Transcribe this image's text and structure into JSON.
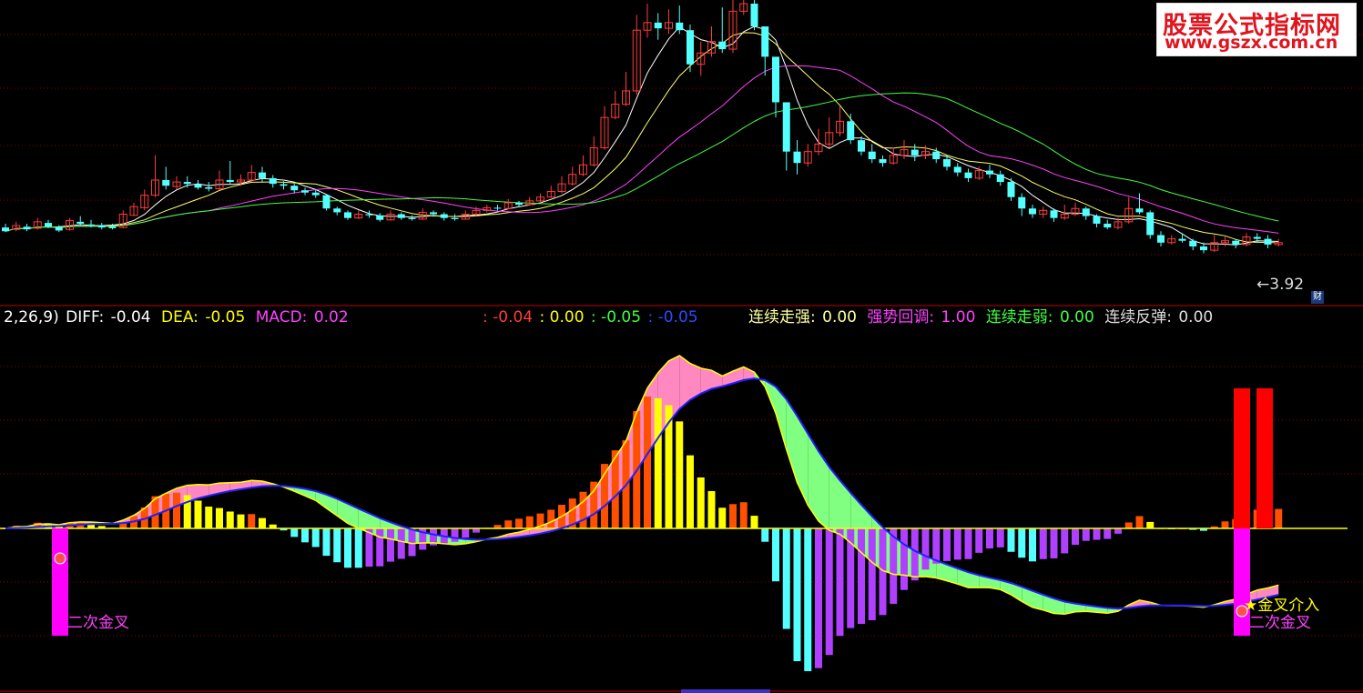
{
  "watermark": {
    "line1": "股票公式指标网",
    "line2": "www.gszx.com.cn"
  },
  "price_panel": {
    "last_price_label": "3.92",
    "badge": "财"
  },
  "legend": {
    "params": "2,26,9)",
    "diff_label": "DIFF:",
    "diff_value": "-0.04",
    "dea_label": "DEA:",
    "dea_value": "-0.05",
    "macd_label": "MACD:",
    "macd_value": "0.02",
    "v1": ": -0.04",
    "v2": ": 0.00",
    "v3": ": -0.05",
    "v4": ": -0.05",
    "s1_label": "连续走强:",
    "s1_value": "0.00",
    "s2_label": "强势回调:",
    "s2_value": "1.00",
    "s3_label": "连续走弱:",
    "s3_value": "0.00",
    "s4_label": "连续反弹:",
    "s4_value": "0.00"
  },
  "signals": {
    "second_golden_cross": "二次金叉",
    "golden_cross_buy": "★金叉介入"
  },
  "colors": {
    "up": "#ff3c3c",
    "down": "#54ffff",
    "ma5": "#ffffff",
    "ma10": "#ffff66",
    "ma20": "#ff40ff",
    "ma30": "#40ff40",
    "diff": "#ffff00",
    "dea": "#2020ff",
    "bar_orange": "#ff5000",
    "bar_yellow": "#ffff00",
    "bar_cyan": "#54ffff",
    "bar_violet": "#b040ff",
    "fill_pink": "#ff88c0",
    "fill_green": "#80ff80",
    "signal_magenta": "#ff00ff",
    "signal_red": "#ff0000"
  },
  "chart_data": [
    {
      "type": "candlestick",
      "title": "",
      "ylabel": "",
      "ylim": [
        3.5,
        10.5
      ],
      "candles": [
        [
          4.6,
          4.5,
          4.7,
          4.48
        ],
        [
          4.55,
          4.65,
          4.75,
          4.5
        ],
        [
          4.62,
          4.55,
          4.7,
          4.5
        ],
        [
          4.58,
          4.75,
          4.85,
          4.55
        ],
        [
          4.72,
          4.62,
          4.8,
          4.58
        ],
        [
          4.6,
          4.52,
          4.66,
          4.48
        ],
        [
          4.55,
          4.78,
          4.85,
          4.52
        ],
        [
          4.75,
          4.7,
          4.9,
          4.65
        ],
        [
          4.68,
          4.65,
          4.8,
          4.6
        ],
        [
          4.66,
          4.6,
          4.72,
          4.55
        ],
        [
          4.62,
          4.58,
          4.7,
          4.55
        ],
        [
          4.6,
          4.95,
          5.05,
          4.58
        ],
        [
          4.92,
          5.15,
          5.25,
          4.9
        ],
        [
          5.12,
          5.45,
          5.6,
          5.05
        ],
        [
          5.45,
          5.85,
          6.5,
          5.4
        ],
        [
          5.85,
          5.7,
          6.2,
          5.6
        ],
        [
          5.68,
          5.8,
          5.95,
          5.6
        ],
        [
          5.8,
          5.75,
          5.95,
          5.65
        ],
        [
          5.74,
          5.65,
          5.85,
          5.6
        ],
        [
          5.66,
          5.62,
          5.8,
          5.55
        ],
        [
          5.62,
          5.85,
          6.1,
          5.58
        ],
        [
          5.85,
          5.8,
          6.35,
          5.75
        ],
        [
          5.8,
          5.85,
          6.0,
          5.7
        ],
        [
          5.85,
          6.05,
          6.25,
          5.8
        ],
        [
          6.05,
          5.9,
          6.2,
          5.8
        ],
        [
          5.9,
          5.75,
          5.98,
          5.65
        ],
        [
          5.74,
          5.7,
          5.82,
          5.6
        ],
        [
          5.7,
          5.58,
          5.75,
          5.5
        ],
        [
          5.58,
          5.52,
          5.65,
          5.45
        ],
        [
          5.52,
          5.45,
          5.6,
          5.38
        ],
        [
          5.45,
          5.1,
          5.48,
          5.05
        ],
        [
          5.1,
          5.0,
          5.15,
          4.92
        ],
        [
          5.0,
          4.85,
          5.05,
          4.8
        ],
        [
          4.85,
          4.95,
          5.05,
          4.82
        ],
        [
          4.95,
          4.92,
          5.05,
          4.85
        ],
        [
          4.92,
          4.8,
          4.98,
          4.75
        ],
        [
          4.8,
          4.95,
          5.05,
          4.78
        ],
        [
          4.95,
          4.85,
          5.0,
          4.8
        ],
        [
          4.85,
          4.82,
          4.92,
          4.78
        ],
        [
          4.82,
          5.0,
          5.1,
          4.8
        ],
        [
          5.0,
          4.95,
          5.05,
          4.88
        ],
        [
          4.95,
          4.85,
          5.0,
          4.78
        ],
        [
          4.85,
          4.82,
          4.95,
          4.78
        ],
        [
          4.82,
          4.95,
          5.05,
          4.8
        ],
        [
          4.95,
          5.05,
          5.15,
          4.9
        ],
        [
          5.05,
          5.12,
          5.2,
          5.0
        ],
        [
          5.12,
          5.1,
          5.2,
          5.05
        ],
        [
          5.1,
          5.25,
          5.35,
          5.08
        ],
        [
          5.25,
          5.2,
          5.3,
          5.15
        ],
        [
          5.2,
          5.3,
          5.4,
          5.18
        ],
        [
          5.3,
          5.4,
          5.5,
          5.25
        ],
        [
          5.4,
          5.55,
          5.7,
          5.38
        ],
        [
          5.55,
          5.75,
          5.95,
          5.5
        ],
        [
          5.75,
          6.0,
          6.2,
          5.7
        ],
        [
          6.0,
          6.25,
          6.5,
          5.95
        ],
        [
          6.25,
          6.7,
          7.0,
          6.2
        ],
        [
          6.7,
          7.5,
          7.8,
          6.65
        ],
        [
          7.5,
          7.85,
          8.2,
          7.45
        ],
        [
          7.85,
          8.2,
          8.7,
          7.8
        ],
        [
          8.2,
          9.8,
          10.2,
          8.1
        ],
        [
          9.8,
          10.0,
          10.5,
          9.6
        ],
        [
          10.0,
          9.85,
          10.25,
          9.55
        ],
        [
          9.85,
          10.0,
          10.35,
          9.7
        ],
        [
          10.0,
          9.8,
          10.45,
          9.7
        ],
        [
          9.8,
          8.9,
          9.95,
          8.7
        ],
        [
          8.9,
          9.2,
          9.5,
          8.6
        ],
        [
          9.2,
          9.5,
          9.9,
          9.1
        ],
        [
          9.5,
          9.3,
          10.4,
          9.2
        ],
        [
          9.3,
          10.3,
          10.6,
          9.2
        ],
        [
          10.3,
          10.5,
          10.8,
          10.2
        ],
        [
          10.5,
          9.9,
          10.6,
          9.8
        ],
        [
          9.9,
          9.1,
          9.6,
          8.6
        ],
        [
          9.1,
          7.9,
          8.3,
          7.5
        ],
        [
          7.9,
          6.6,
          7.4,
          6.1
        ],
        [
          6.6,
          6.3,
          6.9,
          6.0
        ],
        [
          6.3,
          6.6,
          6.8,
          6.2
        ],
        [
          6.6,
          6.8,
          7.2,
          6.5
        ],
        [
          6.8,
          7.1,
          7.5,
          6.7
        ],
        [
          7.1,
          7.4,
          7.8,
          7.0
        ],
        [
          7.4,
          6.9,
          7.6,
          6.8
        ],
        [
          6.9,
          6.6,
          7.0,
          6.5
        ],
        [
          6.6,
          6.4,
          6.8,
          6.3
        ],
        [
          6.4,
          6.3,
          6.5,
          6.2
        ],
        [
          6.3,
          6.5,
          6.7,
          6.25
        ],
        [
          6.5,
          6.65,
          6.9,
          6.4
        ],
        [
          6.65,
          6.5,
          6.8,
          6.35
        ],
        [
          6.5,
          6.6,
          6.75,
          6.4
        ],
        [
          6.6,
          6.4,
          6.7,
          6.3
        ],
        [
          6.4,
          6.2,
          6.5,
          6.1
        ],
        [
          6.2,
          6.05,
          6.3,
          5.95
        ],
        [
          6.05,
          5.9,
          6.15,
          5.8
        ],
        [
          5.9,
          6.1,
          6.2,
          5.85
        ],
        [
          6.1,
          6.0,
          6.25,
          5.9
        ],
        [
          6.0,
          5.8,
          6.1,
          5.7
        ],
        [
          5.8,
          5.4,
          5.9,
          5.3
        ],
        [
          5.4,
          5.1,
          5.5,
          4.9
        ],
        [
          5.1,
          4.95,
          5.2,
          4.85
        ],
        [
          4.95,
          5.05,
          5.15,
          4.85
        ],
        [
          5.05,
          4.85,
          5.1,
          4.75
        ],
        [
          4.85,
          4.95,
          5.2,
          4.8
        ],
        [
          4.95,
          5.1,
          5.25,
          4.9
        ],
        [
          5.1,
          4.9,
          5.15,
          4.8
        ],
        [
          4.9,
          4.7,
          4.95,
          4.6
        ],
        [
          4.7,
          4.6,
          4.8,
          4.55
        ],
        [
          4.6,
          4.75,
          4.85,
          4.55
        ],
        [
          4.75,
          5.1,
          5.4,
          4.7
        ],
        [
          5.1,
          5.0,
          5.5,
          4.95
        ],
        [
          5.0,
          4.4,
          5.05,
          4.3
        ],
        [
          4.4,
          4.2,
          4.5,
          4.1
        ],
        [
          4.2,
          4.3,
          4.4,
          4.15
        ],
        [
          4.3,
          4.25,
          4.45,
          4.2
        ],
        [
          4.25,
          4.1,
          4.3,
          4.0
        ],
        [
          4.1,
          4.0,
          4.2,
          3.92
        ],
        [
          4.0,
          4.2,
          4.4,
          3.95
        ],
        [
          4.2,
          4.25,
          4.35,
          4.1
        ],
        [
          4.25,
          4.15,
          4.3,
          4.05
        ],
        [
          4.15,
          4.35,
          4.45,
          4.1
        ],
        [
          4.35,
          4.3,
          4.45,
          4.2
        ],
        [
          4.3,
          4.15,
          4.4,
          4.05
        ],
        [
          4.15,
          4.2,
          4.3,
          4.1
        ]
      ],
      "annotations": [
        "3.92"
      ]
    },
    {
      "type": "bar",
      "title": "",
      "ylabel": "",
      "ylim": [
        -0.6,
        0.75
      ],
      "series": [
        {
          "name": "DIFF",
          "values": []
        },
        {
          "name": "DEA",
          "values": []
        },
        {
          "name": "MACD",
          "values": []
        }
      ]
    }
  ]
}
